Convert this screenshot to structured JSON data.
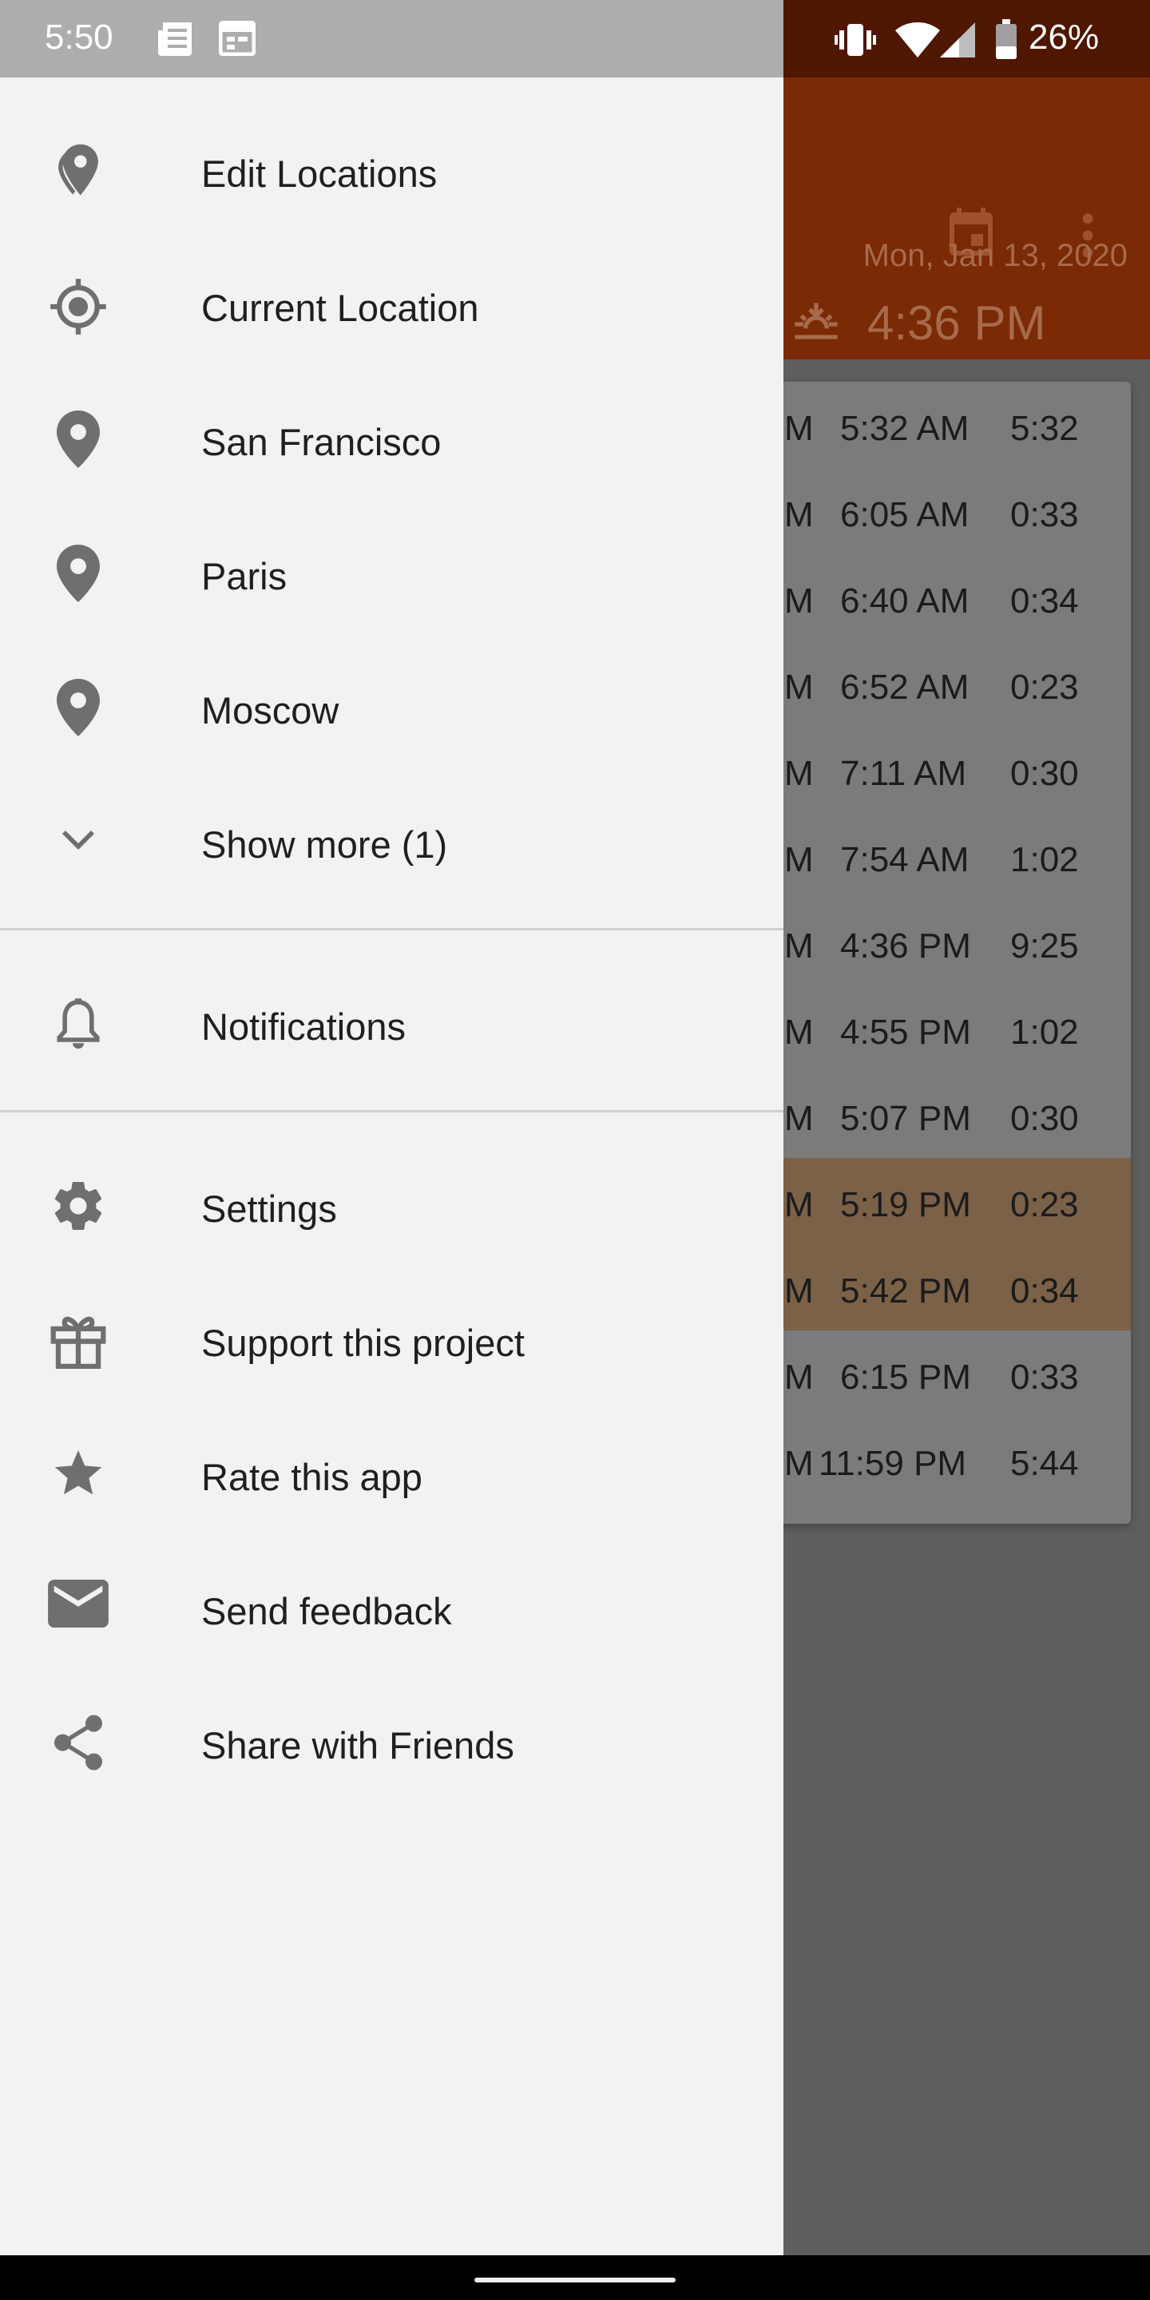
{
  "status_bar": {
    "time": "5:50",
    "battery_percent": "26%",
    "left_icons": [
      "news-icon",
      "calendar-grid-icon"
    ],
    "right_icons": [
      "vibrate-icon",
      "wifi-icon",
      "signal-icon",
      "battery-icon"
    ]
  },
  "drawer": {
    "locations": [
      {
        "label": "Edit Locations",
        "icon": "edit-location-icon"
      },
      {
        "label": "Current Location",
        "icon": "crosshair-icon"
      },
      {
        "label": "San Francisco",
        "icon": "pin-icon"
      },
      {
        "label": "Paris",
        "icon": "pin-icon"
      },
      {
        "label": "Moscow",
        "icon": "pin-icon"
      },
      {
        "label": "Show more (1)",
        "icon": "chevron-down-icon"
      }
    ],
    "notifications": {
      "label": "Notifications",
      "icon": "bell-icon"
    },
    "footer": [
      {
        "label": "Settings",
        "icon": "gear-icon"
      },
      {
        "label": "Support this project",
        "icon": "gift-icon"
      },
      {
        "label": "Rate this app",
        "icon": "star-icon"
      },
      {
        "label": "Send feedback",
        "icon": "mail-icon"
      },
      {
        "label": "Share with Friends",
        "icon": "share-icon"
      }
    ]
  },
  "background_app": {
    "date": "Mon, Jan 13, 2020",
    "current_time": "4:36 PM",
    "toolbar_icons": [
      "calendar-icon",
      "overflow-menu-icon",
      "sunset-icon"
    ],
    "rows": [
      {
        "c1": "M",
        "c2": "5:32 AM",
        "c3": "5:32",
        "highlight": false
      },
      {
        "c1": "M",
        "c2": "6:05 AM",
        "c3": "0:33",
        "highlight": false
      },
      {
        "c1": "M",
        "c2": "6:40 AM",
        "c3": "0:34",
        "highlight": false
      },
      {
        "c1": "M",
        "c2": "6:52 AM",
        "c3": "0:23",
        "highlight": false
      },
      {
        "c1": "M",
        "c2": "7:11 AM",
        "c3": "0:30",
        "highlight": false
      },
      {
        "c1": "M",
        "c2": "7:54 AM",
        "c3": "1:02",
        "highlight": false
      },
      {
        "c1": "M",
        "c2": "4:36 PM",
        "c3": "9:25",
        "highlight": false
      },
      {
        "c1": "M",
        "c2": "4:55 PM",
        "c3": "1:02",
        "highlight": false
      },
      {
        "c1": "M",
        "c2": "5:07 PM",
        "c3": "0:30",
        "highlight": false
      },
      {
        "c1": "M",
        "c2": "5:19 PM",
        "c3": "0:23",
        "highlight": true
      },
      {
        "c1": "M",
        "c2": "5:42 PM",
        "c3": "0:34",
        "highlight": true
      },
      {
        "c1": "M",
        "c2": "6:15 PM",
        "c3": "0:33",
        "highlight": false
      },
      {
        "c1": "M",
        "c2": "11:59 PM",
        "c3": "5:44",
        "highlight": false
      }
    ]
  },
  "colors": {
    "drawer_bg": "#f2f2f2",
    "icon_gray": "#6f6f6f",
    "scrim": "#5e5e5e",
    "toolbar_dimmed": "#7a2a05",
    "highlight_row": "#7b6148"
  }
}
